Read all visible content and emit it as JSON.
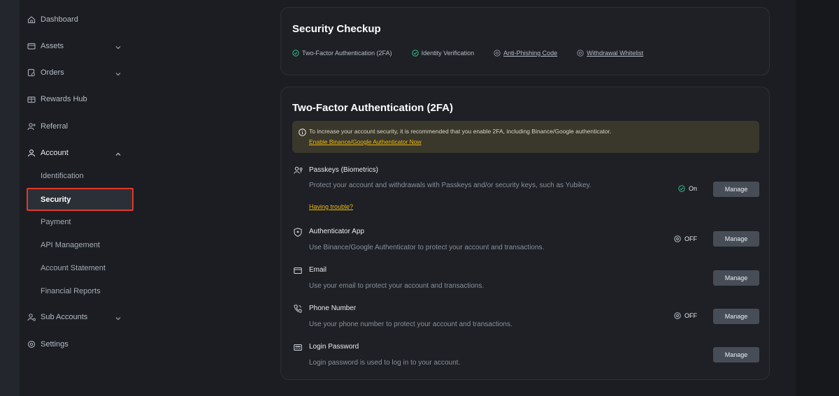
{
  "sidebar": {
    "items": [
      {
        "label": "Dashboard",
        "icon": "home-icon"
      },
      {
        "label": "Assets",
        "icon": "wallet-icon"
      },
      {
        "label": "Orders",
        "icon": "orders-icon"
      },
      {
        "label": "Rewards Hub",
        "icon": "gift-icon"
      },
      {
        "label": "Referral",
        "icon": "referral-icon"
      },
      {
        "label": "Account",
        "icon": "user-icon"
      },
      {
        "label": "Sub Accounts",
        "icon": "sub-accounts-icon"
      },
      {
        "label": "Settings",
        "icon": "settings-icon"
      }
    ],
    "account_sub": [
      {
        "label": "Identification"
      },
      {
        "label": "Security",
        "active": true
      },
      {
        "label": "Payment"
      },
      {
        "label": "API Management"
      },
      {
        "label": "Account Statement"
      },
      {
        "label": "Financial Reports"
      }
    ]
  },
  "checkup": {
    "title": "Security Checkup",
    "items": [
      {
        "label": "Two-Factor Authentication (2FA)",
        "done": true
      },
      {
        "label": "Identity Verification",
        "done": true
      },
      {
        "label": "Anti-Phishing Code",
        "done": false
      },
      {
        "label": "Withdrawal Whitelist",
        "done": false
      }
    ]
  },
  "twofa": {
    "title": "Two-Factor Authentication (2FA)",
    "notice_text": "To increase your account security, it is recommended that you enable 2FA, including Binance/Google authenticator.",
    "notice_link": "Enable Binance/Google Authenticator Now",
    "rows": [
      {
        "title": "Passkeys (Biometrics)",
        "desc": "Protect your account and withdrawals with Passkeys and/or security keys, such as Yubikey.",
        "link": "Having trouble?",
        "status": "On",
        "button": "Manage"
      },
      {
        "title": "Authenticator App",
        "desc": "Use Binance/Google Authenticator to protect your account and transactions.",
        "status": "OFF",
        "button": "Manage"
      },
      {
        "title": "Email",
        "desc": "Use your email to protect your account and transactions.",
        "button": "Manage"
      },
      {
        "title": "Phone Number",
        "desc": "Use your phone number to protect your account and transactions.",
        "status": "OFF",
        "button": "Manage"
      },
      {
        "title": "Login Password",
        "desc": "Login password is used to log in to your account.",
        "button": "Manage"
      }
    ]
  },
  "colors": {
    "accent": "#f0b90b",
    "success": "#2ebd85",
    "highlight": "#e0392b"
  }
}
